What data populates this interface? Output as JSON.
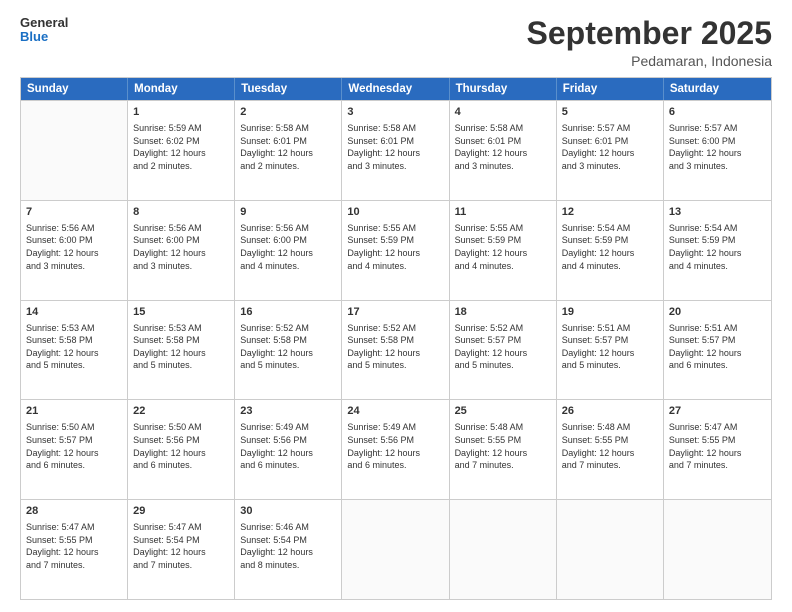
{
  "header": {
    "logo_general": "General",
    "logo_blue": "Blue",
    "month_title": "September 2025",
    "subtitle": "Pedamaran, Indonesia"
  },
  "weekdays": [
    "Sunday",
    "Monday",
    "Tuesday",
    "Wednesday",
    "Thursday",
    "Friday",
    "Saturday"
  ],
  "weeks": [
    [
      {
        "day": "",
        "text": ""
      },
      {
        "day": "1",
        "text": "Sunrise: 5:59 AM\nSunset: 6:02 PM\nDaylight: 12 hours\nand 2 minutes."
      },
      {
        "day": "2",
        "text": "Sunrise: 5:58 AM\nSunset: 6:01 PM\nDaylight: 12 hours\nand 2 minutes."
      },
      {
        "day": "3",
        "text": "Sunrise: 5:58 AM\nSunset: 6:01 PM\nDaylight: 12 hours\nand 3 minutes."
      },
      {
        "day": "4",
        "text": "Sunrise: 5:58 AM\nSunset: 6:01 PM\nDaylight: 12 hours\nand 3 minutes."
      },
      {
        "day": "5",
        "text": "Sunrise: 5:57 AM\nSunset: 6:01 PM\nDaylight: 12 hours\nand 3 minutes."
      },
      {
        "day": "6",
        "text": "Sunrise: 5:57 AM\nSunset: 6:00 PM\nDaylight: 12 hours\nand 3 minutes."
      }
    ],
    [
      {
        "day": "7",
        "text": "Sunrise: 5:56 AM\nSunset: 6:00 PM\nDaylight: 12 hours\nand 3 minutes."
      },
      {
        "day": "8",
        "text": "Sunrise: 5:56 AM\nSunset: 6:00 PM\nDaylight: 12 hours\nand 3 minutes."
      },
      {
        "day": "9",
        "text": "Sunrise: 5:56 AM\nSunset: 6:00 PM\nDaylight: 12 hours\nand 4 minutes."
      },
      {
        "day": "10",
        "text": "Sunrise: 5:55 AM\nSunset: 5:59 PM\nDaylight: 12 hours\nand 4 minutes."
      },
      {
        "day": "11",
        "text": "Sunrise: 5:55 AM\nSunset: 5:59 PM\nDaylight: 12 hours\nand 4 minutes."
      },
      {
        "day": "12",
        "text": "Sunrise: 5:54 AM\nSunset: 5:59 PM\nDaylight: 12 hours\nand 4 minutes."
      },
      {
        "day": "13",
        "text": "Sunrise: 5:54 AM\nSunset: 5:59 PM\nDaylight: 12 hours\nand 4 minutes."
      }
    ],
    [
      {
        "day": "14",
        "text": "Sunrise: 5:53 AM\nSunset: 5:58 PM\nDaylight: 12 hours\nand 5 minutes."
      },
      {
        "day": "15",
        "text": "Sunrise: 5:53 AM\nSunset: 5:58 PM\nDaylight: 12 hours\nand 5 minutes."
      },
      {
        "day": "16",
        "text": "Sunrise: 5:52 AM\nSunset: 5:58 PM\nDaylight: 12 hours\nand 5 minutes."
      },
      {
        "day": "17",
        "text": "Sunrise: 5:52 AM\nSunset: 5:58 PM\nDaylight: 12 hours\nand 5 minutes."
      },
      {
        "day": "18",
        "text": "Sunrise: 5:52 AM\nSunset: 5:57 PM\nDaylight: 12 hours\nand 5 minutes."
      },
      {
        "day": "19",
        "text": "Sunrise: 5:51 AM\nSunset: 5:57 PM\nDaylight: 12 hours\nand 5 minutes."
      },
      {
        "day": "20",
        "text": "Sunrise: 5:51 AM\nSunset: 5:57 PM\nDaylight: 12 hours\nand 6 minutes."
      }
    ],
    [
      {
        "day": "21",
        "text": "Sunrise: 5:50 AM\nSunset: 5:57 PM\nDaylight: 12 hours\nand 6 minutes."
      },
      {
        "day": "22",
        "text": "Sunrise: 5:50 AM\nSunset: 5:56 PM\nDaylight: 12 hours\nand 6 minutes."
      },
      {
        "day": "23",
        "text": "Sunrise: 5:49 AM\nSunset: 5:56 PM\nDaylight: 12 hours\nand 6 minutes."
      },
      {
        "day": "24",
        "text": "Sunrise: 5:49 AM\nSunset: 5:56 PM\nDaylight: 12 hours\nand 6 minutes."
      },
      {
        "day": "25",
        "text": "Sunrise: 5:48 AM\nSunset: 5:55 PM\nDaylight: 12 hours\nand 7 minutes."
      },
      {
        "day": "26",
        "text": "Sunrise: 5:48 AM\nSunset: 5:55 PM\nDaylight: 12 hours\nand 7 minutes."
      },
      {
        "day": "27",
        "text": "Sunrise: 5:47 AM\nSunset: 5:55 PM\nDaylight: 12 hours\nand 7 minutes."
      }
    ],
    [
      {
        "day": "28",
        "text": "Sunrise: 5:47 AM\nSunset: 5:55 PM\nDaylight: 12 hours\nand 7 minutes."
      },
      {
        "day": "29",
        "text": "Sunrise: 5:47 AM\nSunset: 5:54 PM\nDaylight: 12 hours\nand 7 minutes."
      },
      {
        "day": "30",
        "text": "Sunrise: 5:46 AM\nSunset: 5:54 PM\nDaylight: 12 hours\nand 8 minutes."
      },
      {
        "day": "",
        "text": ""
      },
      {
        "day": "",
        "text": ""
      },
      {
        "day": "",
        "text": ""
      },
      {
        "day": "",
        "text": ""
      }
    ]
  ]
}
